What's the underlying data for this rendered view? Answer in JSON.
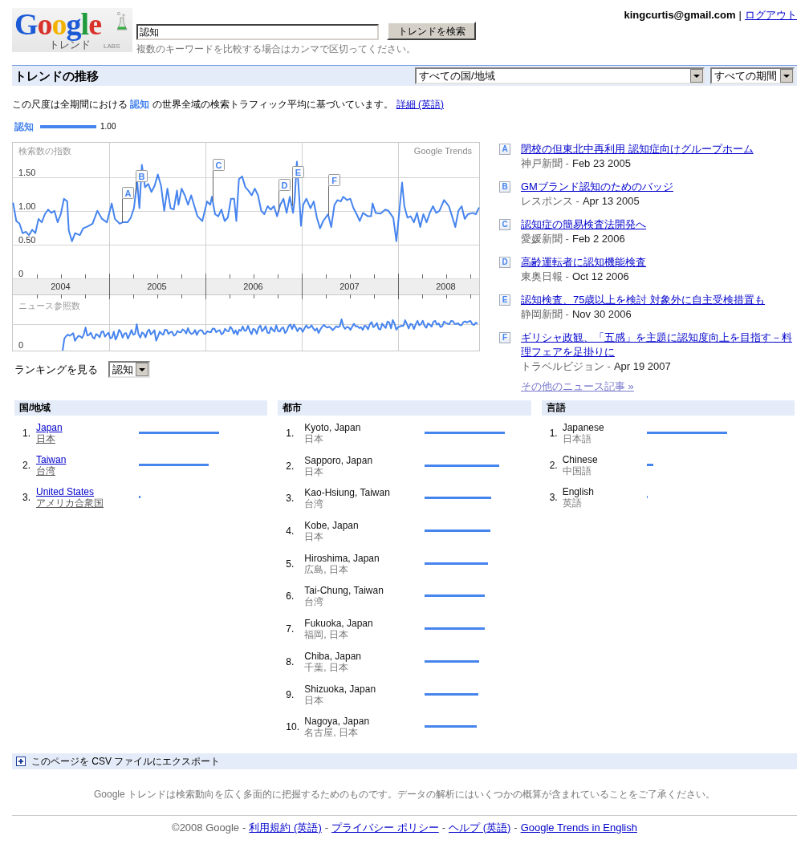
{
  "header": {
    "logo": {
      "wordmark": "Google",
      "subtitle": "トレンド",
      "badge": "LABS"
    },
    "search": {
      "value": "認知",
      "button": "トレンドを検索",
      "hint": "複数のキーワードを比較する場合はカンマで区切ってください。"
    },
    "account": {
      "email": "kingcurtis@gmail.com",
      "separator": "|",
      "logout": "ログアウト"
    }
  },
  "trends_bar": {
    "title": "トレンドの推移",
    "region_select": "すべての国/地域",
    "period_select": "すべての期間"
  },
  "description": {
    "text": "この尺度は全期間における **認知** の世界全域の検索トラフィック平均に基づいています。",
    "link": "詳細 (英語)"
  },
  "chart": {
    "legend_value": "1.00",
    "brand_label": "Google Trends",
    "news_label": "ニュース参照数",
    "news_zero_label": "0",
    "chart_data": {
      "type": "line",
      "ylabel": "検索数の指数",
      "grid": true,
      "x": [
        2004.007,
        2004.04,
        2004.073,
        2004.106,
        2004.139,
        2004.172,
        2004.205,
        2004.238,
        2004.271,
        2004.304,
        2004.337,
        2004.37,
        2004.403,
        2004.436,
        2004.469,
        2004.502,
        2004.535,
        2004.568,
        2004.585,
        2004.618,
        2004.651,
        2004.7,
        2004.733,
        2004.783,
        2004.832,
        2004.882,
        2004.931,
        2004.981,
        2005.031,
        2005.064,
        2005.113,
        2005.146,
        2005.196,
        2005.229,
        2005.262,
        2005.295,
        2005.318,
        2005.344,
        2005.377,
        2005.41,
        2005.443,
        2005.476,
        2005.51,
        2005.543,
        2005.576,
        2005.609,
        2005.642,
        2005.675,
        2005.708,
        2005.724,
        2005.757,
        2005.79,
        2005.823,
        2005.856,
        2005.889,
        2005.922,
        2005.972,
        2006.021,
        2006.054,
        2006.071,
        2006.104,
        2006.137,
        2006.17,
        2006.203,
        2006.236,
        2006.269,
        2006.302,
        2006.325,
        2006.352,
        2006.385,
        2006.418,
        2006.451,
        2006.484,
        2006.517,
        2006.55,
        2006.583,
        2006.616,
        2006.649,
        2006.682,
        2006.715,
        2006.748,
        2006.781,
        2006.814,
        2006.847,
        2006.88,
        2006.913,
        2006.93,
        2006.953,
        2006.979,
        2006.996,
        2007.019,
        2007.052,
        2007.095,
        2007.128,
        2007.161,
        2007.194,
        2007.227,
        2007.277,
        2007.31,
        2007.343,
        2007.376,
        2007.409,
        2007.435,
        2007.475,
        2007.508,
        2007.541,
        2007.574,
        2007.607,
        2007.64,
        2007.69,
        2007.723,
        2007.739,
        2007.772,
        2007.822,
        2007.871,
        2007.904,
        2007.954,
        2007.987,
        2008.02,
        2008.046,
        2008.069,
        2008.102,
        2008.135,
        2008.168,
        2008.201,
        2008.234,
        2008.267,
        2008.3,
        2008.333,
        2008.367,
        2008.4,
        2008.433,
        2008.482,
        2008.532,
        2008.565,
        2008.598,
        2008.631,
        2008.664,
        2008.697,
        2008.73,
        2008.779,
        2008.812,
        2008.845
      ],
      "series": [
        {
          "name": "認知",
          "color": "#4684ee",
          "values": [
            1.12,
            0.85,
            0.81,
            0.67,
            0.69,
            0.64,
            0.72,
            0.67,
            0.88,
            0.83,
            0.95,
            1.02,
            0.97,
            1.0,
            0.83,
            0.95,
            1.18,
            1.14,
            0.71,
            0.55,
            0.67,
            0.64,
            0.74,
            0.77,
            0.81,
            1.0,
            0.88,
            0.83,
            1.11,
            0.88,
            0.81,
            0.83,
            0.83,
            0.9,
            1.04,
            1.44,
            1.04,
            1.68,
            1.35,
            1.4,
            1.28,
            1.37,
            1.54,
            1.37,
            1.0,
            1.33,
            1.04,
            1.02,
            1.3,
            1.09,
            1.33,
            1.23,
            1.09,
            1.23,
            1.07,
            0.92,
            0.85,
            1.14,
            1.09,
            1.21,
            0.95,
            0.92,
            1.02,
            0.85,
            0.9,
            1.18,
            1.18,
            0.85,
            1.47,
            1.51,
            1.35,
            1.3,
            1.23,
            1.33,
            1.23,
            1.0,
            0.95,
            1.07,
            1.02,
            1.07,
            0.92,
            1.09,
            1.18,
            0.97,
            1.21,
            0.97,
            1.16,
            1.73,
            1.18,
            0.78,
            1.09,
            1.18,
            1.04,
            1.14,
            0.9,
            0.74,
            0.85,
            0.95,
            0.76,
            1.09,
            1.16,
            1.14,
            1.21,
            1.16,
            1.18,
            1.04,
            0.95,
            0.85,
            0.97,
            0.92,
            0.92,
            1.11,
            0.97,
            0.96,
            1.02,
            1.0,
            0.9,
            0.55,
            1.04,
            1.42,
            1.07,
            0.9,
            0.92,
            0.83,
            0.97,
            0.76,
            0.95,
            0.83,
            0.97,
            1.07,
            0.97,
            1.0,
            1.16,
            1.07,
            0.92,
            0.76,
            1.0,
            1.07,
            0.88,
            0.95,
            0.97,
            0.95,
            1.05
          ]
        }
      ],
      "xlim": [
        2004,
        2008.85
      ],
      "ylim": [
        0,
        2.02
      ],
      "xticks": [
        {
          "value": 2004.5,
          "label": "2004"
        },
        {
          "value": 2005.5,
          "label": "2005"
        },
        {
          "value": 2006.5,
          "label": "2006"
        },
        {
          "value": 2007.5,
          "label": "2007"
        },
        {
          "value": 2008.5,
          "label": "2008"
        }
      ],
      "yticks": [
        {
          "value": 0,
          "label": "0"
        },
        {
          "value": 0.5,
          "label": "0.50"
        },
        {
          "value": 1,
          "label": "1.00"
        },
        {
          "value": 1.5,
          "label": "1.50"
        }
      ],
      "annotations": [
        {
          "x": 2005.14,
          "y": 0.83,
          "text": "A"
        },
        {
          "x": 2005.28,
          "y": 1.26,
          "text": "B"
        },
        {
          "x": 2006.08,
          "y": 1.14,
          "text": "C"
        },
        {
          "x": 2006.76,
          "y": 0.98,
          "text": "D"
        },
        {
          "x": 2006.9,
          "y": 1.07,
          "text": "E"
        },
        {
          "x": 2007.28,
          "y": 0.93,
          "text": "F"
        }
      ]
    }
  },
  "ranking_selector": {
    "label": "ランキングを見る",
    "value": "認知"
  },
  "news": {
    "items": [
      {
        "marker": "A",
        "title": "閉校の但東北中再利用 認知症向けグループホーム",
        "source": "神戸新聞 -",
        "date": "Feb 23 2005"
      },
      {
        "marker": "B",
        "title": "GMブランド認知のためのバッジ",
        "source": "レスポンス -",
        "date": "Apr 13 2005"
      },
      {
        "marker": "C",
        "title": "認知症の簡易検査法開発へ",
        "source": "愛媛新聞 -",
        "date": "Feb 2 2006"
      },
      {
        "marker": "D",
        "title": "高齢運転者に認知機能検査",
        "source": "東奥日報 -",
        "date": "Oct 12 2006"
      },
      {
        "marker": "E",
        "title": "認知検査、75歳以上を検討 対象外に自主受検措置も",
        "source": "静岡新聞 -",
        "date": "Nov 30 2006"
      },
      {
        "marker": "F",
        "title": "ギリシャ政観、「五感」を主題に認知度向上を目指す－料理フェアを足掛りに",
        "source": "トラベルビジョン -",
        "date": "Apr 19 2007"
      }
    ],
    "more": "その他のニュース記事 »"
  },
  "rankings": [
    {
      "kind": "country",
      "title": "国/地域",
      "rows": [
        {
          "rank": "1.",
          "name": "Japan",
          "local": "日本",
          "level": 1.0
        },
        {
          "rank": "2.",
          "name": "Taiwan",
          "local": "台湾",
          "level": 0.87
        },
        {
          "rank": "3.",
          "name": "United States",
          "local": "アメリカ合衆国",
          "level": 0.02
        }
      ]
    },
    {
      "kind": "city",
      "title": "都市",
      "rows": [
        {
          "rank": "1.",
          "name": "Kyoto, Japan",
          "local": "日本",
          "level": 1.0
        },
        {
          "rank": "2.",
          "name": "Sapporo, Japan",
          "local": "日本",
          "level": 0.93
        },
        {
          "rank": "3.",
          "name": "Kao-Hsiung, Taiwan",
          "local": "台湾",
          "level": 0.83
        },
        {
          "rank": "4.",
          "name": "Kobe, Japan",
          "local": "日本",
          "level": 0.82
        },
        {
          "rank": "5.",
          "name": "Hiroshima, Japan",
          "local": "広島, 日本",
          "level": 0.79
        },
        {
          "rank": "6.",
          "name": "Tai-Chung, Taiwan",
          "local": "台湾",
          "level": 0.75
        },
        {
          "rank": "7.",
          "name": "Fukuoka, Japan",
          "local": "福岡, 日本",
          "level": 0.75
        },
        {
          "rank": "8.",
          "name": "Chiba, Japan",
          "local": "千葉, 日本",
          "level": 0.68
        },
        {
          "rank": "9.",
          "name": "Shizuoka, Japan",
          "local": "日本",
          "level": 0.67
        },
        {
          "rank": "10.",
          "name": "Nagoya, Japan",
          "local": "名古屋, 日本",
          "level": 0.65
        }
      ]
    },
    {
      "kind": "language",
      "title": "言語",
      "rows": [
        {
          "rank": "1.",
          "name": "Japanese",
          "local": "日本語",
          "level": 1.0
        },
        {
          "rank": "2.",
          "name": "Chinese",
          "local": "中国語",
          "level": 0.08
        },
        {
          "rank": "3.",
          "name": "English",
          "local": "英語",
          "level": 0.01
        }
      ]
    }
  ],
  "export": {
    "label": "このページを CSV ファイルにエクスポート"
  },
  "disclaimer": "Google トレンドは検索動向を広く多面的に把握するためのものです。データの解析にはいくつかの概算が含まれていることをご了承ください。",
  "footer": [
    {
      "kind": "text",
      "text": "©2008 Google"
    },
    {
      "kind": "separator",
      "text": "-"
    },
    {
      "kind": "link",
      "text": "利用規約 (英語)"
    },
    {
      "kind": "separator",
      "text": "-"
    },
    {
      "kind": "link",
      "text": "プライバシー ポリシー"
    },
    {
      "kind": "separator",
      "text": "-"
    },
    {
      "kind": "link",
      "text": "ヘルプ (英語)"
    },
    {
      "kind": "separator",
      "text": "-"
    },
    {
      "kind": "link",
      "text": "Google Trends in English"
    }
  ]
}
